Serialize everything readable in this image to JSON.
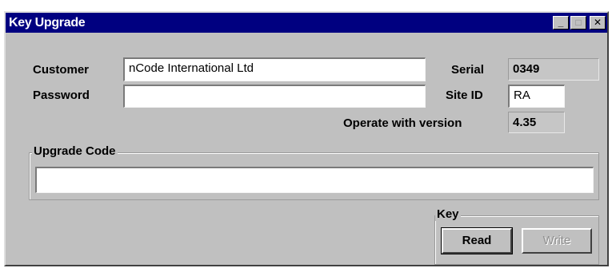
{
  "window": {
    "title": "Key Upgrade",
    "controls": {
      "minimize": "_",
      "maximize": "□",
      "close": "✕"
    }
  },
  "form": {
    "customer_label": "Customer",
    "customer_value": "nCode International Ltd",
    "password_label": "Password",
    "password_value": "",
    "serial_label": "Serial",
    "serial_value": "0349",
    "site_id_label": "Site ID",
    "site_id_value": "RA",
    "version_label": "Operate with version",
    "version_value": "4.35"
  },
  "upgrade": {
    "group_label": "Upgrade Code",
    "code_value": ""
  },
  "key": {
    "group_label": "Key",
    "read_label": "Read",
    "write_label": "Write"
  },
  "colors": {
    "titlebar": "#000080",
    "face": "#c0c0c0",
    "field": "#ffffff"
  }
}
